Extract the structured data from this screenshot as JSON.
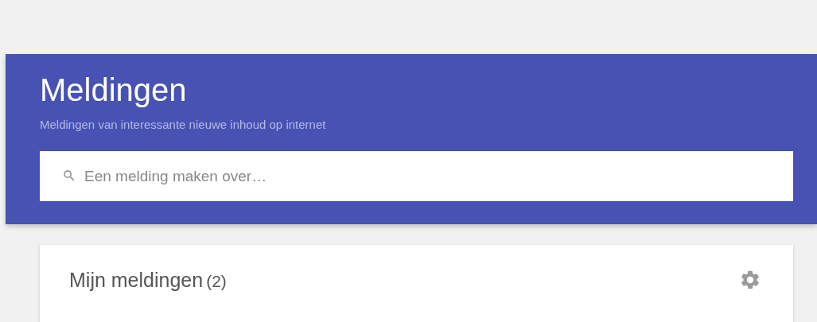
{
  "header": {
    "title": "Meldingen",
    "subtitle": "Meldingen van interessante nieuwe inhoud op internet"
  },
  "search": {
    "placeholder": "Een melding maken over…"
  },
  "card": {
    "title": "Mijn meldingen",
    "count": "(2)"
  }
}
